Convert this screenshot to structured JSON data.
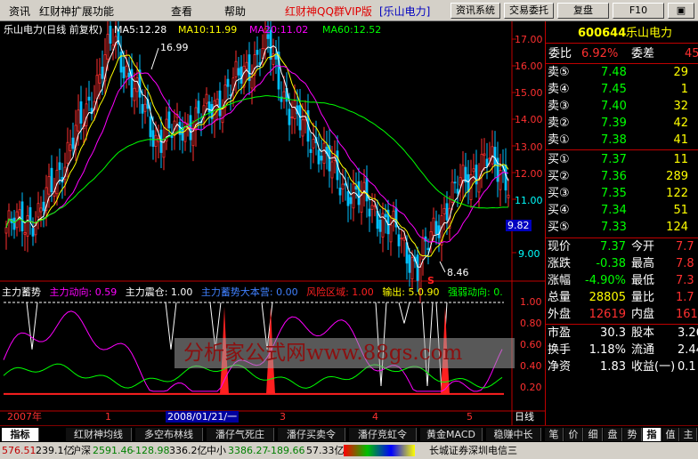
{
  "menubar": {
    "items": [
      "资讯",
      "红财神扩展功能",
      "查看",
      "帮助"
    ],
    "promo": "红财神QQ群VIP版",
    "stock_tag": "[乐山电力]",
    "buttons": [
      "资讯系统",
      "交易委托",
      "复盘",
      "F10"
    ]
  },
  "chart": {
    "title": "乐山电力(日线 前复权)",
    "ma": [
      {
        "label": "MA5:12.28",
        "color": "#ffffff"
      },
      {
        "label": "MA10:11.99",
        "color": "#ffff00"
      },
      {
        "label": "MA20:11.02",
        "color": "#ff00ff"
      },
      {
        "label": "MA60:12.52",
        "color": "#00ff00"
      }
    ],
    "price_axis": [
      "17.00",
      "16.00",
      "15.00",
      "14.00",
      "13.00",
      "12.00",
      "11.00",
      "9.82",
      "9.00"
    ],
    "high_label": "16.99",
    "low_label": "8.46",
    "indicator_legend": [
      {
        "label": "主力蓄势",
        "color": "#ffffff"
      },
      {
        "label": "主力动向: 0.59",
        "color": "#ff00ff"
      },
      {
        "label": "主力震仓: 1.00",
        "color": "#ffffff"
      },
      {
        "label": "主力蓄势大本营: 0.00",
        "color": "#4080ff"
      },
      {
        "label": "风险区域: 1.00",
        "color": "#ff2020"
      },
      {
        "label": "输出: 5.0.90",
        "color": "#ffff00"
      },
      {
        "label": "强弱动向: 0.",
        "color": "#00ff00"
      }
    ],
    "indicator_axis": [
      "1.00",
      "0.80",
      "0.60",
      "0.40",
      "0.20"
    ],
    "watermark": "分析家公式网www.88gs.com",
    "date_axis": [
      "2007年",
      "1",
      "2008/01/21/一",
      "3",
      "4",
      "5"
    ],
    "period": "日线",
    "chart_data": {
      "type": "candlestick",
      "title": "乐山电力(日线 前复权)",
      "ylim": [
        8.2,
        17.3
      ],
      "max": 16.99,
      "min": 8.46,
      "current": 9.82
    }
  },
  "quote": {
    "code": "600644",
    "name": "乐山电力",
    "webi_label": "委比",
    "webi_value": "6.92%",
    "weicha_label": "委差",
    "weicha_value": "45",
    "sell": [
      {
        "label": "卖⑤",
        "price": "7.48",
        "vol": "29"
      },
      {
        "label": "卖④",
        "price": "7.45",
        "vol": "1"
      },
      {
        "label": "卖③",
        "price": "7.40",
        "vol": "32"
      },
      {
        "label": "卖②",
        "price": "7.39",
        "vol": "42"
      },
      {
        "label": "卖①",
        "price": "7.38",
        "vol": "41"
      }
    ],
    "buy": [
      {
        "label": "买①",
        "price": "7.37",
        "vol": "11"
      },
      {
        "label": "买②",
        "price": "7.36",
        "vol": "289"
      },
      {
        "label": "买③",
        "price": "7.35",
        "vol": "122"
      },
      {
        "label": "买④",
        "price": "7.34",
        "vol": "51"
      },
      {
        "label": "买⑤",
        "price": "7.33",
        "vol": "124"
      }
    ],
    "stats": [
      {
        "l1": "现价",
        "v1": "7.37",
        "c1": "#00ff00",
        "l2": "今开",
        "v2": "7.7"
      },
      {
        "l1": "涨跌",
        "v1": "-0.38",
        "c1": "#00ff00",
        "l2": "最高",
        "v2": "7.8"
      },
      {
        "l1": "涨幅",
        "v1": "-4.90%",
        "c1": "#00ff00",
        "l2": "最低",
        "v2": "7.3"
      },
      {
        "l1": "总量",
        "v1": "28805",
        "c1": "#ffff00",
        "l2": "量比",
        "v2": "1.7"
      },
      {
        "l1": "外盘",
        "v1": "12619",
        "c1": "#ff3030",
        "l2": "内盘",
        "v2": "1618"
      }
    ],
    "fin": [
      {
        "l1": "市盈",
        "v1": "30.3",
        "l2": "股本",
        "v2": "3.26"
      },
      {
        "l1": "换手",
        "v1": "1.18%",
        "l2": "流通",
        "v2": "2.44"
      },
      {
        "l1": "净资",
        "v1": "1.83",
        "l2": "收益(一)",
        "v2": "0.1"
      }
    ]
  },
  "tabs": {
    "items": [
      "指标",
      "红财神均线",
      "多空布林线",
      "潘仔气死庄",
      "潘仔买卖令",
      "潘仔竞虹令",
      "黄金MACD",
      "稳赚中长"
    ],
    "right": [
      "笔",
      "价",
      "细",
      "盘",
      "势",
      "指",
      "值",
      "主"
    ]
  },
  "status": {
    "left_value": "576.51",
    "left_amount": "239.1亿",
    "sh_label": "沪深",
    "sh_value": "2591.46",
    "sh_change": "-128.98",
    "sh_amount": "336.2亿",
    "zx_label": "中小",
    "zx_value": "3386.27",
    "zx_change": "-189.66",
    "zx_amount": "57.33亿",
    "broker": "长城证券深圳电信三"
  }
}
